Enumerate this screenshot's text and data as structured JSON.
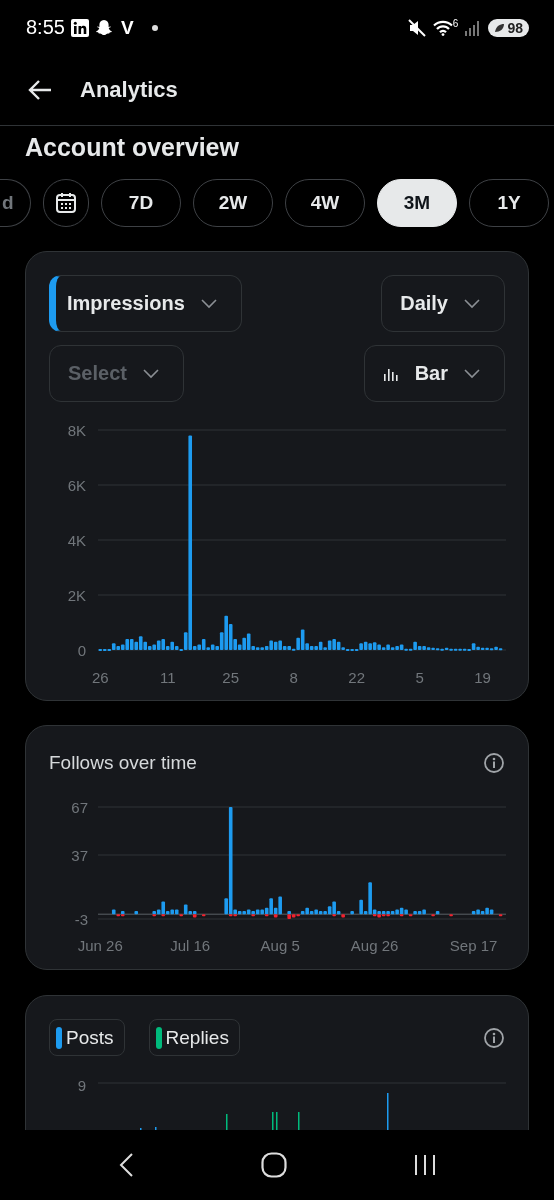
{
  "status_bar": {
    "time": "8:55",
    "carrier_letter": "V",
    "wifi_badge": "6",
    "battery": "98"
  },
  "header": {
    "title": "Analytics"
  },
  "section_title": "Account overview",
  "range_chips": [
    {
      "kind": "text",
      "label": "d",
      "selected": false
    },
    {
      "kind": "calendar",
      "selected": false
    },
    {
      "kind": "text",
      "label": "7D",
      "selected": false
    },
    {
      "kind": "text",
      "label": "2W",
      "selected": false
    },
    {
      "kind": "text",
      "label": "4W",
      "selected": false
    },
    {
      "kind": "text",
      "label": "3M",
      "selected": true
    },
    {
      "kind": "text",
      "label": "1Y",
      "selected": false
    }
  ],
  "impressions_card": {
    "metric_dropdown": {
      "label": "Impressions"
    },
    "interval_dropdown": {
      "label": "Daily"
    },
    "compare_dropdown": {
      "placeholder": "Select",
      "disabled": true
    },
    "chart_type_dropdown": {
      "label": "Bar"
    },
    "chart_data": {
      "type": "bar",
      "grid": true,
      "categories": [
        "26",
        null,
        null,
        null,
        null,
        null,
        null,
        null,
        null,
        null,
        null,
        null,
        null,
        null,
        null,
        "11",
        null,
        null,
        null,
        null,
        null,
        null,
        null,
        null,
        null,
        null,
        null,
        null,
        null,
        "25",
        null,
        null,
        null,
        null,
        null,
        null,
        null,
        null,
        null,
        null,
        null,
        null,
        null,
        "8",
        null,
        null,
        null,
        null,
        null,
        null,
        null,
        null,
        null,
        null,
        null,
        null,
        null,
        "22",
        null,
        null,
        null,
        null,
        null,
        null,
        null,
        null,
        null,
        null,
        null,
        null,
        null,
        "5",
        null,
        null,
        null,
        null,
        null,
        null,
        null,
        null,
        null,
        null,
        null,
        null,
        null,
        "19",
        null,
        null,
        null,
        null
      ],
      "values": [
        40,
        40,
        40,
        250,
        150,
        200,
        400,
        400,
        300,
        500,
        300,
        150,
        200,
        350,
        400,
        150,
        300,
        150,
        40,
        650,
        7800,
        150,
        200,
        400,
        100,
        200,
        150,
        650,
        1250,
        950,
        400,
        200,
        450,
        600,
        150,
        100,
        100,
        150,
        350,
        300,
        350,
        150,
        150,
        50,
        450,
        750,
        250,
        150,
        150,
        300,
        100,
        350,
        400,
        300,
        100,
        40,
        40,
        40,
        250,
        300,
        250,
        280,
        200,
        100,
        200,
        100,
        150,
        200,
        50,
        50,
        300,
        150,
        150,
        100,
        80,
        60,
        50,
        80,
        50,
        50,
        50,
        50,
        40,
        250,
        120,
        80,
        80,
        60,
        120,
        60
      ],
      "ylim": [
        0,
        8000
      ],
      "yticks": [
        {
          "value": 0,
          "label": "0"
        },
        {
          "value": 2000,
          "label": "2K"
        },
        {
          "value": 4000,
          "label": "4K"
        },
        {
          "value": 6000,
          "label": "6K"
        },
        {
          "value": 8000,
          "label": "8K"
        }
      ]
    }
  },
  "follows_card": {
    "title": "Follows over time",
    "chart_data": {
      "type": "bar",
      "stacked": true,
      "grid": true,
      "categories": [
        "Jun 26",
        null,
        null,
        null,
        null,
        null,
        null,
        null,
        null,
        null,
        null,
        null,
        null,
        null,
        null,
        null,
        null,
        null,
        null,
        null,
        "Jul 16",
        null,
        null,
        null,
        null,
        null,
        null,
        null,
        null,
        null,
        null,
        null,
        null,
        null,
        null,
        null,
        null,
        null,
        null,
        null,
        "Aug 5",
        null,
        null,
        null,
        null,
        null,
        null,
        null,
        null,
        null,
        null,
        null,
        null,
        null,
        null,
        null,
        null,
        null,
        null,
        null,
        null,
        "Aug 26",
        null,
        null,
        null,
        null,
        null,
        null,
        null,
        null,
        null,
        null,
        null,
        null,
        null,
        null,
        null,
        null,
        null,
        null,
        null,
        null,
        null,
        "Sep 17",
        null,
        null,
        null,
        null,
        null,
        null
      ],
      "series": [
        {
          "color": "#1d9bf0",
          "values": [
            0,
            0,
            0,
            3,
            0,
            2,
            0,
            0,
            2,
            0,
            0,
            0,
            2,
            3,
            8,
            2,
            3,
            3,
            0,
            6,
            2,
            2,
            0,
            0,
            0,
            0,
            0,
            0,
            10,
            67,
            3,
            2,
            2,
            3,
            2,
            3,
            3,
            4,
            10,
            4,
            11,
            0,
            2,
            0,
            0,
            2,
            4,
            2,
            3,
            2,
            2,
            5,
            8,
            2,
            0,
            0,
            2,
            0,
            9,
            2,
            20,
            3,
            2,
            2,
            2,
            2,
            3,
            4,
            3,
            0,
            2,
            2,
            3,
            0,
            0,
            2,
            0,
            0,
            0,
            0,
            0,
            0,
            0,
            2,
            3,
            2,
            4,
            3,
            0,
            0
          ]
        },
        {
          "color": "#f4212e",
          "values": [
            0,
            0,
            0,
            0,
            -1,
            -1,
            0,
            0,
            0,
            0,
            0,
            0,
            -1,
            0,
            -1,
            0,
            0,
            0,
            -1,
            0,
            0,
            -2,
            0,
            -1,
            0,
            0,
            0,
            0,
            0,
            -1,
            -1,
            0,
            0,
            0,
            -1,
            0,
            0,
            -1,
            0,
            -2,
            0,
            0,
            -3,
            -2,
            -1,
            0,
            0,
            0,
            0,
            0,
            0,
            0,
            -1,
            0,
            -2,
            0,
            0,
            0,
            0,
            0,
            0,
            -1,
            -2,
            -1,
            -1,
            0,
            0,
            -1,
            0,
            -1,
            0,
            0,
            0,
            0,
            -1,
            0,
            0,
            0,
            -1,
            0,
            0,
            0,
            0,
            0,
            0,
            0,
            0,
            0,
            0,
            -1
          ]
        }
      ],
      "ylim": [
        -3,
        67
      ],
      "yticks": [
        {
          "value": -3,
          "label": "-3"
        },
        {
          "value": 37,
          "label": "37"
        },
        {
          "value": 67,
          "label": "67"
        }
      ]
    }
  },
  "posts_card": {
    "legend": [
      {
        "label": "Posts",
        "color": "#1d9bf0"
      },
      {
        "label": "Replies",
        "color": "#00ba7c"
      }
    ],
    "y_tick_label": "9"
  }
}
